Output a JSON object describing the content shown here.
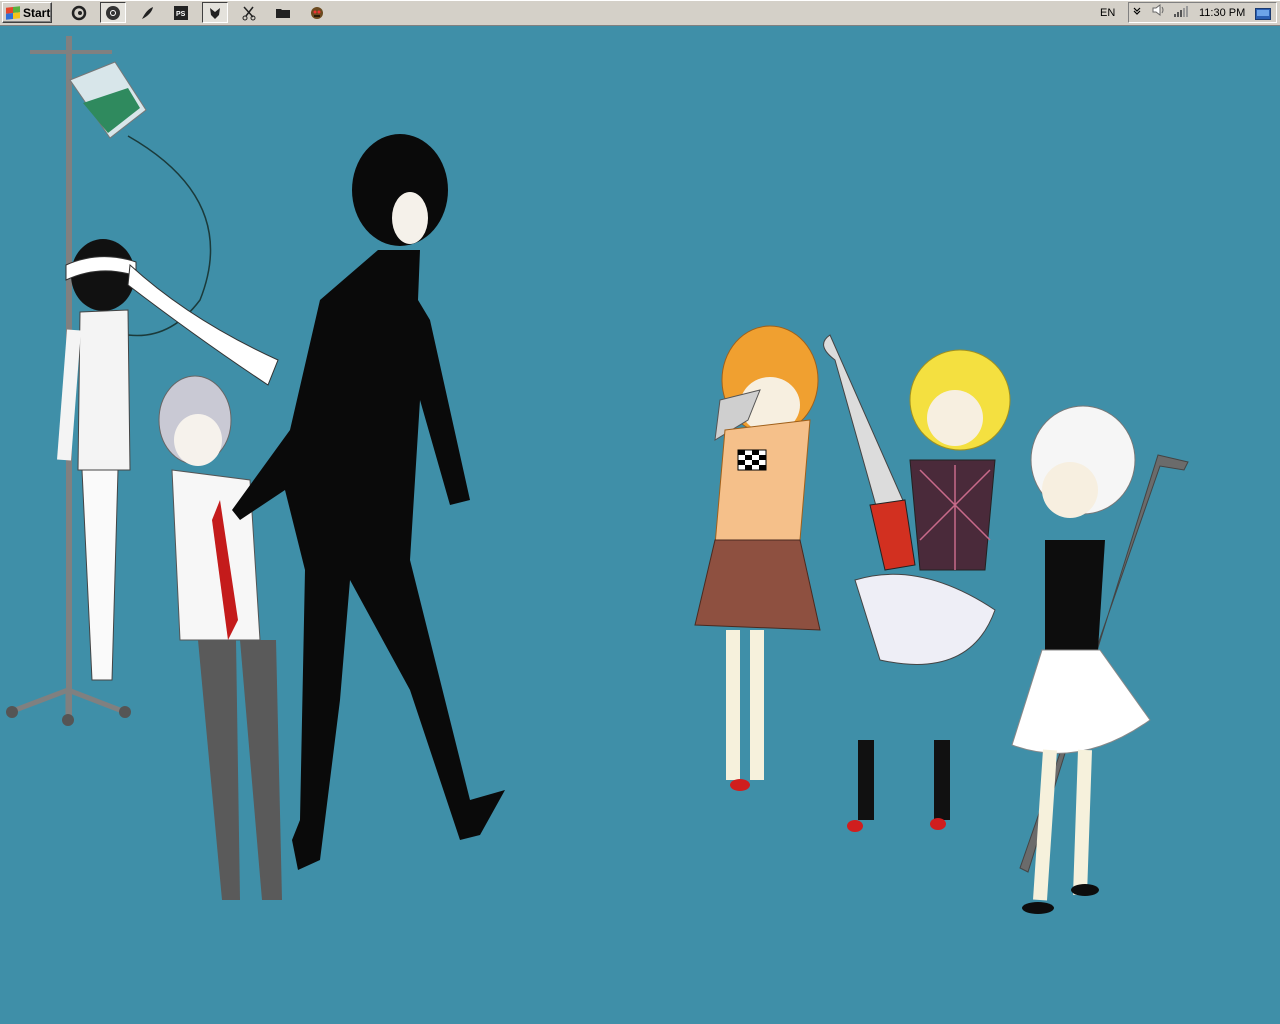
{
  "taskbar": {
    "start_label": "Start",
    "quick_launch": [
      {
        "name": "swirl-app-icon",
        "pressed": false
      },
      {
        "name": "chrome-icon",
        "pressed": true
      },
      {
        "name": "feather-icon",
        "pressed": false
      },
      {
        "name": "photoshop-icon",
        "label": "PS",
        "pressed": false
      },
      {
        "name": "tulip-icon",
        "pressed": true
      },
      {
        "name": "scissors-icon",
        "pressed": false
      },
      {
        "name": "folder-icon",
        "pressed": false
      },
      {
        "name": "game-icon",
        "pressed": false
      }
    ],
    "language": "EN",
    "clock": "11:30 PM"
  },
  "colors": {
    "desktop": "#3f8fa8",
    "taskbar": "#d4d0c8"
  },
  "wallpaper": {
    "subject": "anime-characters-illustration"
  }
}
